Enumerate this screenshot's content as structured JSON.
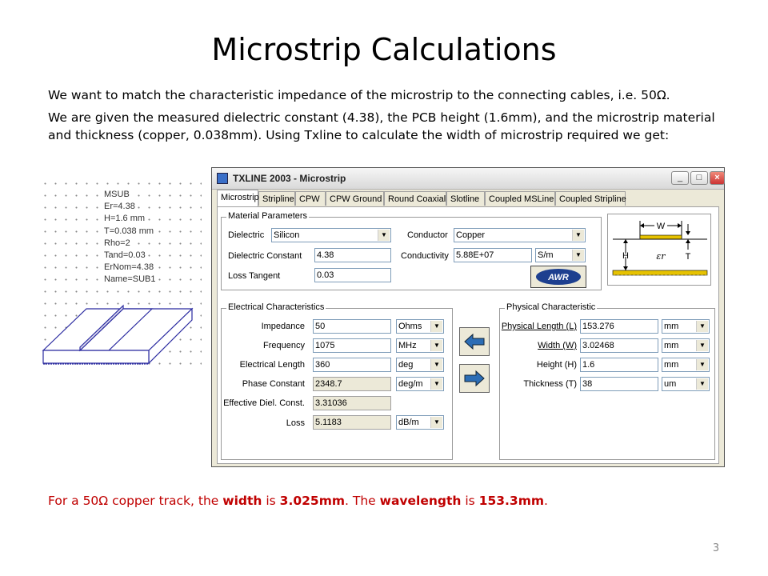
{
  "slide": {
    "title": "Microstrip Calculations",
    "para1": "We want to match the characteristic impedance of the microstrip to the connecting cables, i.e. 50Ω.",
    "para2": "We are given the measured dielectric constant (4.38), the PCB height (1.6mm), and the microstrip material and thickness (copper, 0.038mm). Using Txline to calculate the width of microstrip required we get:",
    "conclusion": {
      "pre": "For a 50Ω copper track, the ",
      "w_label": "width",
      "mid1": " is ",
      "w_value": "3.025mm",
      "mid2": ". The ",
      "wl_label": "wavelength",
      "mid3": " is ",
      "wl_value": "153.3mm",
      "post": "."
    },
    "page_number": "3",
    "accent_color": "#c00000"
  },
  "msub": {
    "lines": [
      "MSUB",
      "Er=4.38",
      "H=1.6 mm",
      "T=0.038 mm",
      "Rho=2",
      "Tand=0.03",
      "ErNom=4.38",
      "Name=SUB1"
    ]
  },
  "window": {
    "title": "TXLINE 2003 - Microstrip",
    "icon": "app-icon",
    "tabs": [
      "Microstrip",
      "Stripline",
      "CPW",
      "CPW Ground",
      "Round Coaxial",
      "Slotline",
      "Coupled MSLine",
      "Coupled Stripline"
    ],
    "active_tab": "Microstrip",
    "material": {
      "group_title": "Material Parameters",
      "dielectric_label": "Dielectric",
      "dielectric_value": "Silicon",
      "conductor_label": "Conductor",
      "conductor_value": "Copper",
      "dielectric_constant_label": "Dielectric Constant",
      "dielectric_constant_value": "4.38",
      "conductivity_label": "Conductivity",
      "conductivity_value": "5.88E+07",
      "conductivity_unit": "S/m",
      "loss_tangent_label": "Loss Tangent",
      "loss_tangent_value": "0.03",
      "logo_text": "AWR"
    },
    "diagram": {
      "w": "W",
      "h": "H",
      "t": "T",
      "er": "εr"
    },
    "electrical": {
      "group_title": "Electrical Characteristics",
      "rows": [
        {
          "label": "Impedance",
          "value": "50",
          "unit": "Ohms"
        },
        {
          "label": "Frequency",
          "value": "1075",
          "unit": "MHz"
        },
        {
          "label": "Electrical Length",
          "value": "360",
          "unit": "deg"
        },
        {
          "label": "Phase Constant",
          "value": "2348.7",
          "unit": "deg/m"
        },
        {
          "label": "Effective Diel. Const.",
          "value": "3.31036",
          "unit": ""
        },
        {
          "label": "Loss",
          "value": "5.1183",
          "unit": "dB/m"
        }
      ]
    },
    "physical": {
      "group_title": "Physical Characteristic",
      "rows": [
        {
          "label": "Physical Length (L)",
          "value": "153.276",
          "unit": "mm"
        },
        {
          "label": "Width (W)",
          "value": "3.02468",
          "unit": "mm"
        },
        {
          "label": "Height (H)",
          "value": "1.6",
          "unit": "mm"
        },
        {
          "label": "Thickness (T)",
          "value": "38",
          "unit": "um"
        }
      ]
    }
  }
}
